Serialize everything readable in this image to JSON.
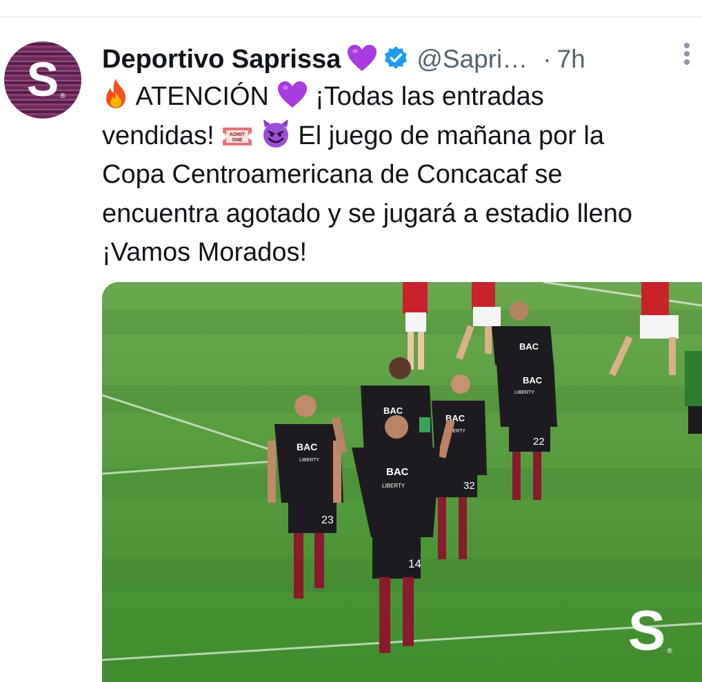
{
  "tweet": {
    "author_name": "Deportivo Saprissa",
    "handle": "@Sapri…",
    "separator": "·",
    "time": "7h",
    "avatar_letter": "S",
    "avatar_mark": "®",
    "lines": {
      "l1_icon1": "fire-emoji",
      "l1_a": "ATENCIÓN",
      "l1_icon2": "purple-heart-emoji",
      "l1_b": "¡Todas las entradas",
      "l2_a": "vendidas!",
      "l2_icon1": "admit-one-ticket-emoji",
      "l2_ticket_text1": "ADMIT",
      "l2_ticket_text2": "ONE",
      "l2_icon2": "smiling-devil-emoji",
      "l2_b": "El juego de mañana por la",
      "l3": "Copa Centroamericana de Concacaf se",
      "l4": "encuentra agotado y se jugará a estadio lleno",
      "l5": "¡Vamos Morados!"
    },
    "media": {
      "watermark_letter": "S",
      "watermark_mark": "®",
      "players": [
        {
          "number": "23",
          "sponsor": "BAC",
          "sponsor2": "LIBERTY"
        },
        {
          "number": "14",
          "sponsor": "BAC",
          "sponsor2": "LIBERTY"
        },
        {
          "number": "32",
          "sponsor": "BAC",
          "sponsor2": "LIBERTY"
        },
        {
          "number": "22",
          "sponsor": "BAC",
          "sponsor2": "LIBERTY"
        },
        {
          "number": "",
          "sponsor": "BAC",
          "sponsor2": ""
        }
      ]
    }
  },
  "colors": {
    "purple_heart": "#a83ce0",
    "verified_blue": "#1d9bf0",
    "muted_text": "#536471",
    "pitch_green": "#4f9a3a",
    "kit_black": "#1d1b1f",
    "opponent_red": "#c8232c"
  }
}
